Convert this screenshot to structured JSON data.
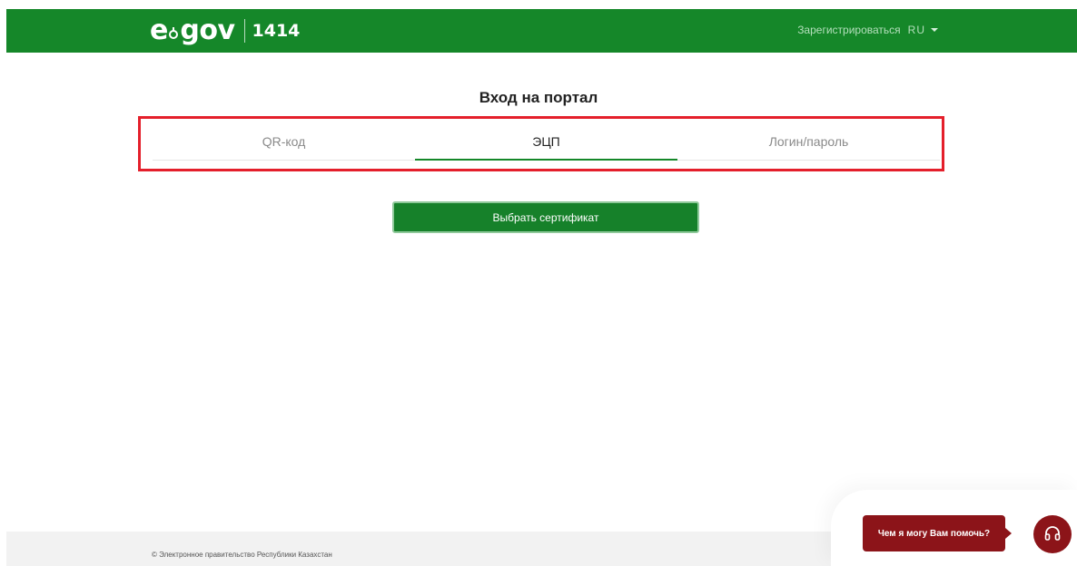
{
  "header": {
    "logo_e": "e",
    "logo_gov": "gov",
    "logo_number": "1414",
    "register_label": "Зарегистрироваться",
    "language": "RU",
    "background_color": "#158729"
  },
  "main": {
    "title": "Вход на портал",
    "tabs": [
      {
        "label": "QR-код",
        "active": false
      },
      {
        "label": "ЭЦП",
        "active": true
      },
      {
        "label": "Логин/пароль",
        "active": false
      }
    ],
    "select_certificate_label": "Выбрать сертификат",
    "highlight_color": "#e41f2b"
  },
  "footer": {
    "copyright": "© Электронное правительство Республики Казахстан"
  },
  "help": {
    "bubble_label": "Чем я могу Вам помочь?",
    "icon": "headset-icon",
    "color": "#8c1419"
  }
}
